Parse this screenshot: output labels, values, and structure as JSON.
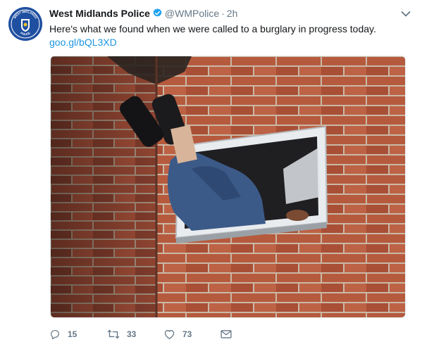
{
  "tweet": {
    "author_name": "West Midlands Police",
    "author_handle": "@WMPolice",
    "separator": "·",
    "time": "2h",
    "text": "Here's what we found when we were called to a burglary in progress today.",
    "link_text": "goo.gl/bQL3XD",
    "avatar_text_top": "WEST MIDLANDS",
    "avatar_text_bottom": "POLICE"
  },
  "actions": {
    "reply_count": "15",
    "retweet_count": "33",
    "like_count": "73"
  },
  "icons": {
    "verified": "verified-badge-icon",
    "caret": "chevron-down-icon",
    "reply": "reply-icon",
    "retweet": "retweet-icon",
    "like": "heart-icon",
    "message": "envelope-icon"
  },
  "colors": {
    "link": "#1b95e0",
    "verified": "#1da1f2",
    "muted": "#657786",
    "brick": "#b65a3e",
    "mortar": "#c9b9a6"
  }
}
